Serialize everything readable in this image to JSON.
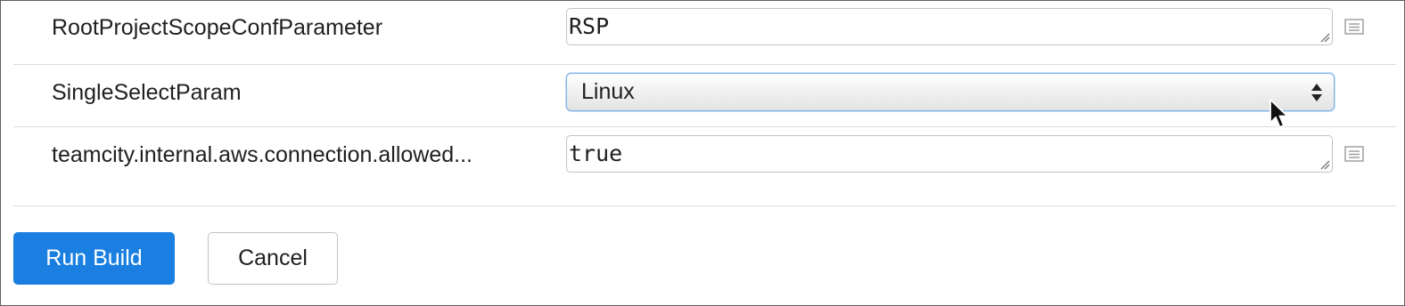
{
  "parameters": [
    {
      "name": "RootProjectScopeConfParameter",
      "type": "text",
      "value": "RSP",
      "edit_icon": "list-icon"
    },
    {
      "name": "SingleSelectParam",
      "type": "select",
      "value": "Linux",
      "arrow_icon": "select-arrows-icon"
    },
    {
      "name": "teamcity.internal.aws.connection.allowed...",
      "type": "text",
      "value": "true",
      "edit_icon": "list-icon"
    }
  ],
  "actions": {
    "run_label": "Run Build",
    "cancel_label": "Cancel"
  },
  "colors": {
    "primary": "#1a7fe0",
    "focus_border": "#7fb3e8",
    "border": "#c3c3c3",
    "separator": "#dcdcdc"
  }
}
